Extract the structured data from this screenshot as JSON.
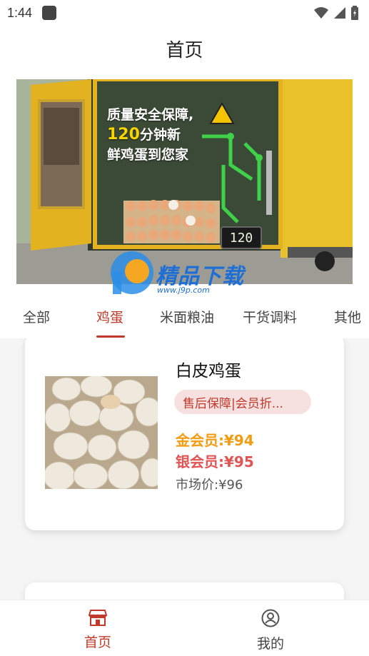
{
  "status_bar": {
    "time": "1:44"
  },
  "header": {
    "title": "首页"
  },
  "banner": {
    "line1": "质量安全保障,",
    "line2_highlight": "120",
    "line2_rest": "分钟新",
    "line3": "鲜鸡蛋到您家",
    "timer": "120",
    "watermark_text": "精品下载",
    "watermark_url": "www.j9p.com"
  },
  "tabs": [
    {
      "label": "全部"
    },
    {
      "label": "鸡蛋"
    },
    {
      "label": "米面粮油"
    },
    {
      "label": "干货调料"
    },
    {
      "label": "其他"
    }
  ],
  "active_tab": "鸡蛋",
  "product": {
    "name": "白皮鸡蛋",
    "tag": "售后保障|会员折...",
    "gold_price": "金会员:¥94",
    "silver_price": "银会员:¥95",
    "market_price": "市场价:¥96"
  },
  "bottom_nav": {
    "home_label": "首页",
    "mine_label": "我的"
  },
  "colors": {
    "accent": "#c0392b",
    "gold": "#f39c12",
    "silver_red": "#e05454",
    "tag_bg": "#f6e1e0"
  }
}
